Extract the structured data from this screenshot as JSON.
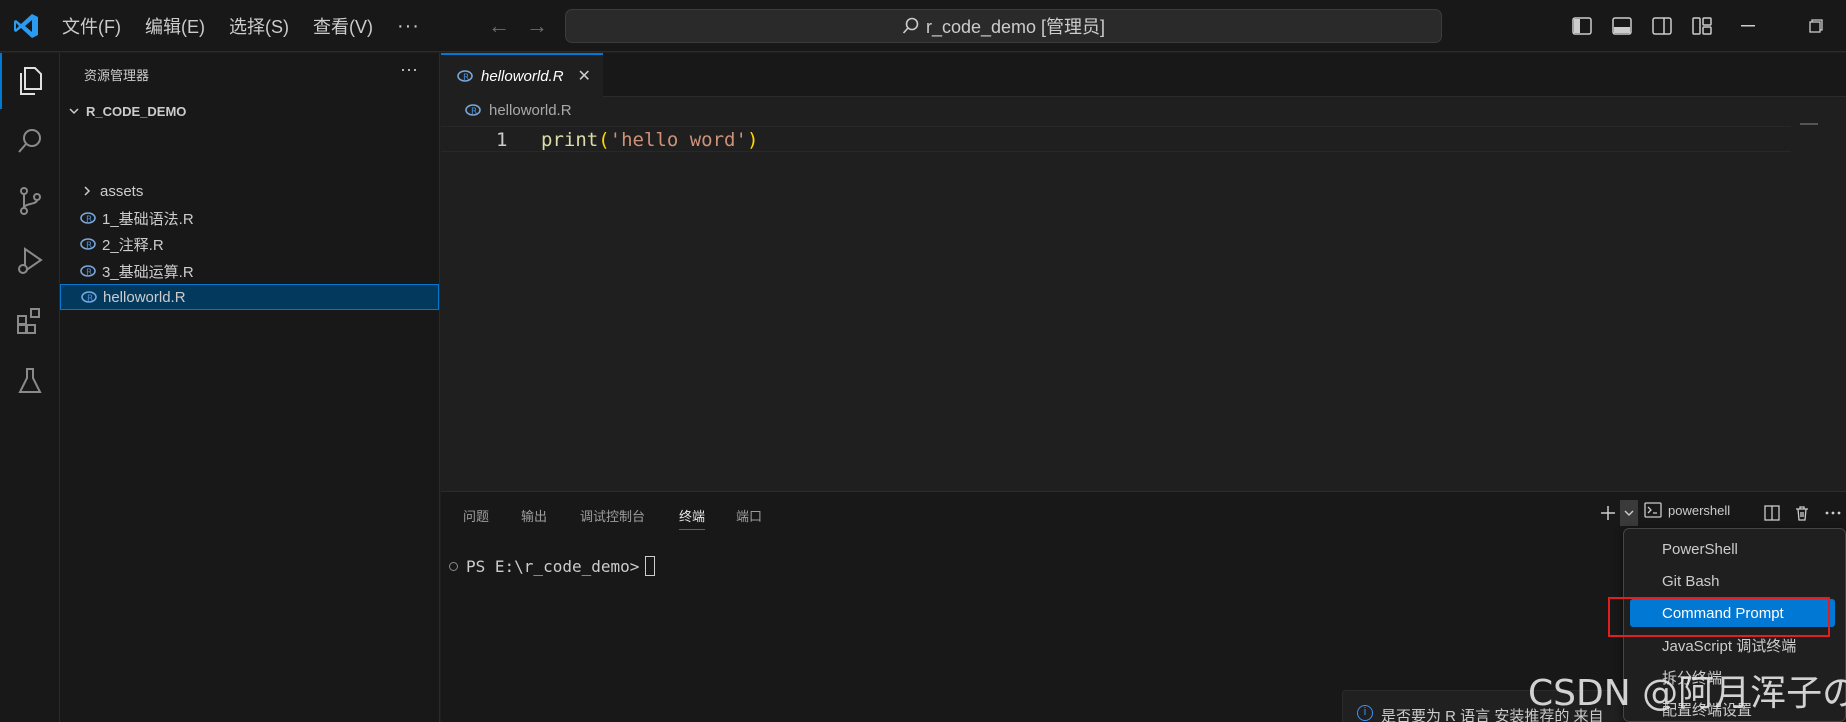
{
  "titlebar": {
    "menu": [
      "文件(F)",
      "编辑(E)",
      "选择(S)",
      "查看(V)"
    ],
    "more": "···",
    "command_center": "r_code_demo [管理员]"
  },
  "sidebar": {
    "title": "资源管理器",
    "more": "···",
    "folder": "R_CODE_DEMO",
    "items": [
      {
        "label": "assets",
        "type": "folder"
      },
      {
        "label": "1_基础语法.R",
        "type": "file"
      },
      {
        "label": "2_注释.R",
        "type": "file"
      },
      {
        "label": "3_基础运算.R",
        "type": "file"
      },
      {
        "label": "helloworld.R",
        "type": "file",
        "selected": true
      }
    ]
  },
  "editor": {
    "tab_label": "helloworld.R",
    "breadcrumb": "helloworld.R",
    "line_number": "1",
    "code": {
      "fn": "print",
      "open": "(",
      "str": "'hello word'",
      "close": ")"
    }
  },
  "panel": {
    "tabs": [
      "问题",
      "输出",
      "调试控制台",
      "终端",
      "端口"
    ],
    "active_tab": "终端",
    "terminal_name": "powershell",
    "prompt": "PS E:\\r_code_demo>"
  },
  "dropdown": {
    "items": [
      "PowerShell",
      "Git Bash",
      "Command Prompt",
      "JavaScript 调试终端",
      "拆分终端",
      "配置终端设置"
    ],
    "active": "Command Prompt"
  },
  "notification": {
    "text": "是否要为 R 语言 安装推荐的 来自"
  },
  "watermark": "CSDN @阿月浑子の",
  "colors": {
    "accent": "#0078d4",
    "highlight_box": "#e02020"
  }
}
